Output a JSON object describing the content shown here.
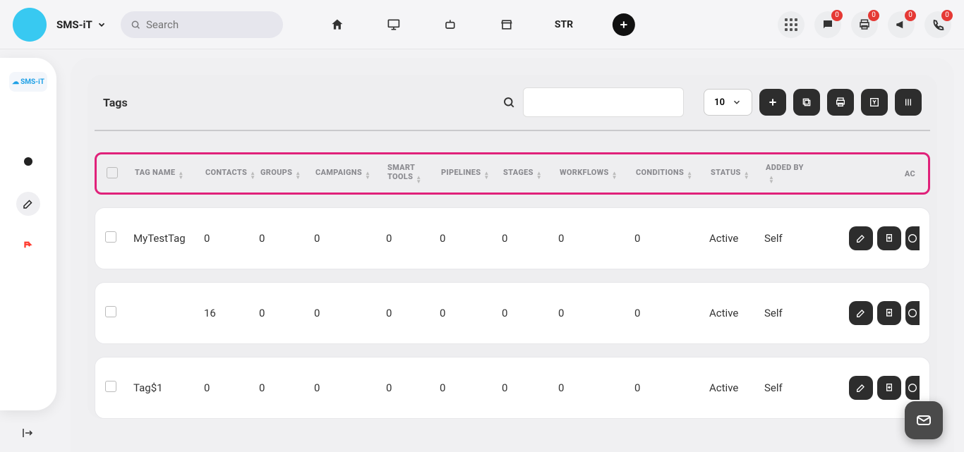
{
  "header": {
    "workspace": "SMS-iT",
    "search_placeholder": "Search",
    "nav_str": "STR",
    "badges": {
      "chat": "0",
      "print": "0",
      "announce": "0",
      "phone": "0"
    }
  },
  "rail": {
    "logo_text": "SMS-iT"
  },
  "panel": {
    "title": "Tags",
    "pager_value": "10"
  },
  "columns": {
    "name": "TAG NAME",
    "contacts": "CONTACTS",
    "groups": "GROUPS",
    "campaigns": "CAMPAIGNS",
    "smart": "SMART TOOLS",
    "pipelines": "PIPELINES",
    "stages": "STAGES",
    "workflows": "WORKFLOWS",
    "conditions": "CONDITIONS",
    "status": "STATUS",
    "addedby": "ADDED BY",
    "actions": "AC"
  },
  "rows": [
    {
      "name": "MyTestTag",
      "contacts": "0",
      "groups": "0",
      "campaigns": "0",
      "smart": "0",
      "pipelines": "0",
      "stages": "0",
      "workflows": "0",
      "conditions": "0",
      "status": "Active",
      "addedby": "Self"
    },
    {
      "name": "",
      "contacts": "16",
      "groups": "0",
      "campaigns": "0",
      "smart": "0",
      "pipelines": "0",
      "stages": "0",
      "workflows": "0",
      "conditions": "0",
      "status": "Active",
      "addedby": "Self"
    },
    {
      "name": "Tag$1",
      "contacts": "0",
      "groups": "0",
      "campaigns": "0",
      "smart": "0",
      "pipelines": "0",
      "stages": "0",
      "workflows": "0",
      "conditions": "0",
      "status": "Active",
      "addedby": "Self"
    }
  ]
}
